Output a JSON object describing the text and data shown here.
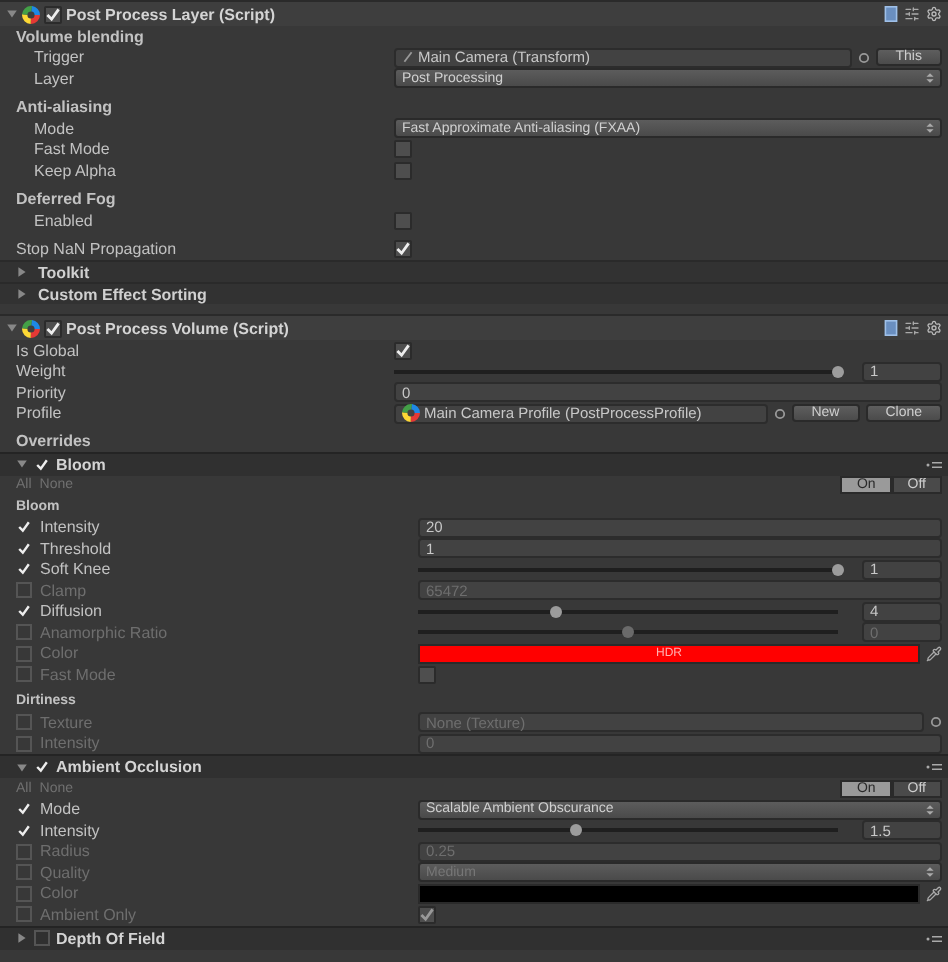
{
  "components": [
    {
      "title": "Post Process Layer (Script)",
      "enabled": true,
      "expanded": true,
      "rows": [
        {
          "kind": "group",
          "label": "Volume blending",
          "children": [
            {
              "kind": "object",
              "label": "Trigger",
              "value": "Main Camera (Transform)",
              "icon": {
                "kind": "transform"
              },
              "buttons": [
                "This"
              ]
            },
            {
              "kind": "dropdown",
              "label": "Layer",
              "value": "Post Processing"
            }
          ]
        },
        {
          "kind": "group",
          "label": "Anti-aliasing",
          "children": [
            {
              "kind": "dropdown",
              "label": "Mode",
              "value": "Fast Approximate Anti-aliasing (FXAA)"
            },
            {
              "kind": "checkbox",
              "label": "Fast Mode",
              "checked": false
            },
            {
              "kind": "checkbox",
              "label": "Keep Alpha",
              "checked": false
            }
          ]
        },
        {
          "kind": "group",
          "label": "Deferred Fog",
          "children": [
            {
              "kind": "checkbox",
              "label": "Enabled",
              "checked": false
            }
          ]
        },
        {
          "kind": "checkbox",
          "label": "Stop NaN Propagation",
          "checked": true
        },
        {
          "kind": "foldout",
          "label": "Toolkit",
          "expanded": false
        },
        {
          "kind": "foldout",
          "label": "Custom Effect Sorting",
          "expanded": false
        }
      ]
    },
    {
      "title": "Post Process Volume (Script)",
      "enabled": true,
      "expanded": true,
      "rows": [
        {
          "kind": "checkbox",
          "label": "Is Global",
          "checked": true
        },
        {
          "kind": "slider",
          "label": "Weight",
          "level": 1,
          "value": "1"
        },
        {
          "kind": "number",
          "label": "Priority",
          "value": "0"
        },
        {
          "kind": "object",
          "label": "Profile",
          "value": "Main Camera Profile (PostProcessProfile)",
          "icon": {
            "kind": "profile"
          },
          "buttons": [
            "New",
            "Clone"
          ]
        },
        {
          "kind": "heading",
          "label": "Overrides"
        }
      ],
      "effects": [
        {
          "title": "Bloom",
          "enabled": true,
          "expanded": true,
          "all": "All",
          "none": "None",
          "toggle": [
            {
              "label": "On",
              "selected": true
            },
            {
              "label": "Off",
              "selected": false
            }
          ],
          "rows": [
            {
              "kind": "label",
              "label": "Bloom"
            },
            {
              "kind": "number",
              "label": "Intensity",
              "override": true,
              "value": "20"
            },
            {
              "kind": "number",
              "label": "Threshold",
              "override": true,
              "value": "1"
            },
            {
              "kind": "slider",
              "label": "Soft Knee",
              "override": true,
              "level": 1,
              "value": "1"
            },
            {
              "kind": "number",
              "label": "Clamp",
              "override": false,
              "value": "65472"
            },
            {
              "kind": "slider",
              "label": "Diffusion",
              "override": true,
              "level": 0.33,
              "value": "4"
            },
            {
              "kind": "slider",
              "label": "Anamorphic Ratio",
              "override": false,
              "level": 0.5,
              "value": "0"
            },
            {
              "kind": "color",
              "label": "Color",
              "override": false,
              "color": "#ff0000",
              "value": "HDR"
            },
            {
              "kind": "checkbox",
              "label": "Fast Mode",
              "override": false,
              "checked": false
            },
            {
              "kind": "label",
              "label": "Dirtiness"
            },
            {
              "kind": "object",
              "label": "Texture",
              "override": false,
              "value": "None (Texture)"
            },
            {
              "kind": "number",
              "label": "Intensity",
              "override": false,
              "value": "0"
            }
          ]
        },
        {
          "title": "Ambient Occlusion",
          "enabled": true,
          "expanded": true,
          "all": "All",
          "none": "None",
          "toggle": [
            {
              "label": "On",
              "selected": true
            },
            {
              "label": "Off",
              "selected": false
            }
          ],
          "rows": [
            {
              "kind": "dropdown",
              "label": "Mode",
              "override": true,
              "value": "Scalable Ambient Obscurance"
            },
            {
              "kind": "slider",
              "label": "Intensity",
              "override": true,
              "level": 0.375,
              "value": "1.5"
            },
            {
              "kind": "number",
              "label": "Radius",
              "override": false,
              "value": "0.25"
            },
            {
              "kind": "dropdown",
              "label": "Quality",
              "override": false,
              "value": "Medium"
            },
            {
              "kind": "color",
              "label": "Color",
              "override": false,
              "color": "#000000"
            },
            {
              "kind": "checkbox",
              "label": "Ambient Only",
              "override": false,
              "checked": true
            }
          ]
        },
        {
          "title": "Depth Of Field",
          "enabled": false,
          "expanded": false
        }
      ]
    }
  ]
}
